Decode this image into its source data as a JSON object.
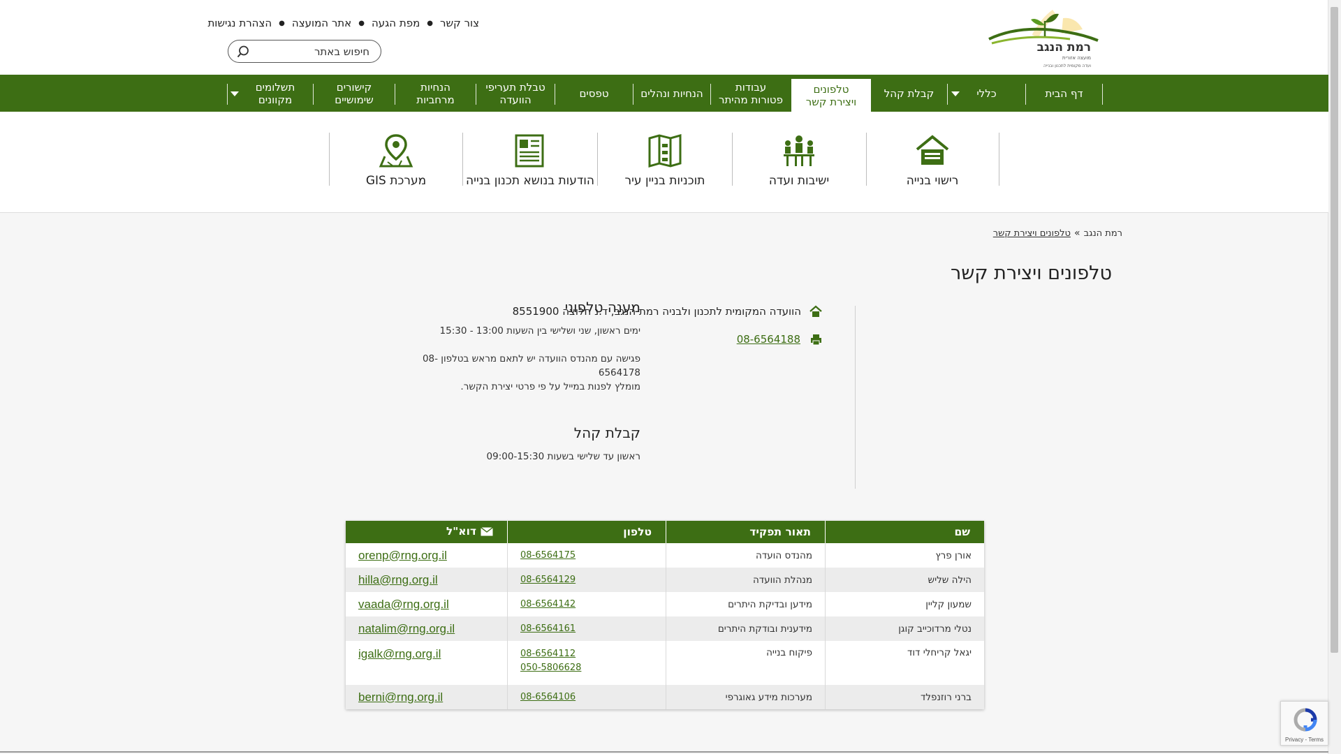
{
  "header": {
    "logo": {
      "title": "רמת הנגב",
      "subtitle": "מועצה אזורית",
      "tagline": "ועדה מקומית לתכנון ובנייה"
    },
    "top_links": [
      "צור קשר",
      "מפת הגעה",
      "אתר המועצה",
      "הצהרת נגישות"
    ],
    "search": {
      "placeholder": "חיפוש באתר",
      "icon": "search-icon"
    }
  },
  "nav": {
    "items": [
      {
        "label": "דף הבית",
        "active": false
      },
      {
        "label": "כללי",
        "active": false,
        "has_dropdown": true
      },
      {
        "label": "קבלת קהל",
        "active": false
      },
      {
        "label": "טלפונים\nויצירת קשר",
        "active": true
      },
      {
        "label": "עבודות\nפטורות מהיתר",
        "active": false
      },
      {
        "label": "הנחיות ונהלים",
        "active": false
      },
      {
        "label": "טפסים",
        "active": false
      },
      {
        "label": "טבלת תעריפי\nהוועדה",
        "active": false
      },
      {
        "label": "הנחיות\nמרחביות",
        "active": false
      },
      {
        "label": "קישורים\nשימושיים",
        "active": false
      },
      {
        "label": "תשלומים\nמקוונים",
        "active": false,
        "has_dropdown": true
      }
    ]
  },
  "shortcuts": [
    {
      "label": "רישוי בנייה",
      "icon": "house-icon"
    },
    {
      "label": "ישיבות ועדה",
      "icon": "meeting-icon"
    },
    {
      "label": "תוכניות בניין עיר",
      "icon": "map-book-icon"
    },
    {
      "label": "הודעות בנושא תכנון בנייה",
      "icon": "newspaper-icon"
    },
    {
      "label": "מערכת GIS",
      "icon": "map-pin-icon"
    }
  ],
  "breadcrumb": {
    "home": "רמת הנגב",
    "separator": "»",
    "current": "טלפונים ויצירת קשר"
  },
  "page": {
    "title": "טלפונים ויצירת קשר",
    "phone_service": {
      "heading": "מענה טלפוני",
      "hours": "ימים ראשון, שני ושלישי בין השעות 13:00 - 15:30",
      "meeting_note_1": "פגישה עם מהנדס הוועדה יש לתאם מראש בטלפון -08",
      "meeting_note_2": "6564178",
      "meeting_note_3": "מומלץ לפנות במייל על פי פרטי יצירת הקשר."
    },
    "reception": {
      "heading": "קבלת קהל",
      "hours": "ראשון עד שלישי בשעות 09:00-15:30"
    },
    "address": "הוועדה המקומית לתכנון ולבניה רמת הנגב, ד.נ חלוצה 8551900",
    "fax": "08-6564188"
  },
  "contacts": {
    "headers": {
      "name": "שם",
      "role": "תאור תפקיד",
      "phone": "טלפון",
      "email": "דוא\"ל"
    },
    "rows": [
      {
        "name": "אורן פרץ",
        "role": "מהנדס הועדה",
        "phones": [
          "08-6564175"
        ],
        "email": "orenp@rng.org.il"
      },
      {
        "name": "הילה שליש",
        "role": "מנהלת הוועדה",
        "phones": [
          "08-6564129"
        ],
        "email": "hilla@rng.org.il"
      },
      {
        "name": "שמעון קליין",
        "role": "מידען ובדיקת היתרים",
        "phones": [
          "08-6564142"
        ],
        "email": "vaada@rng.org.il"
      },
      {
        "name": "נטלי מרדוכייב קוגן",
        "role": "מידענית ובודקת היתרים",
        "phones": [
          "08-6564161"
        ],
        "email": "natalim@rng.org.il"
      },
      {
        "name": "יגאל קריחלי דוד",
        "role": "פיקוח בנייה",
        "phones": [
          "08-6564112",
          "050-5806628"
        ],
        "email": "igalk@rng.org.il"
      },
      {
        "name": "ברני רוזנפלד",
        "role": "מערכות מידע גאוגרפי",
        "phones": [
          "08-6564106"
        ],
        "email": "berni@rng.org.il"
      }
    ]
  },
  "recaptcha": {
    "links": "Privacy - Terms"
  },
  "colors": {
    "brand_green": "#3d6e14",
    "nav_text": "#ffffff",
    "page_bg": "#f6f6f6"
  }
}
